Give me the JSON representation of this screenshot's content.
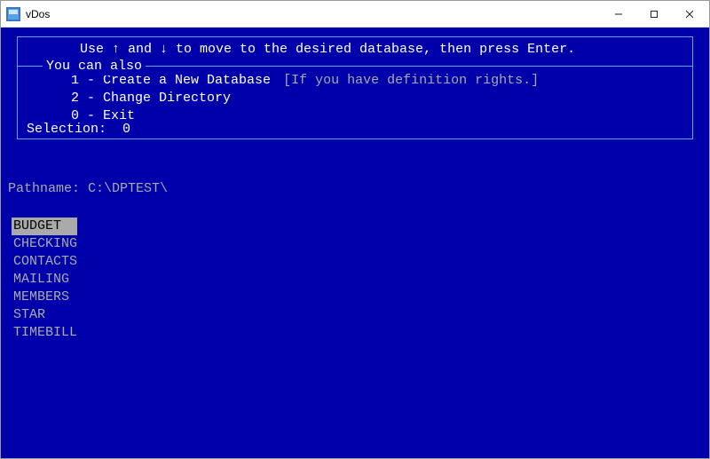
{
  "window": {
    "title": "vDos"
  },
  "terminal": {
    "instruction": "Use ↑ and ↓ to move to the desired database, then press Enter.",
    "subhead": "You can also",
    "options": [
      {
        "num": "1",
        "label": "Create a New Database",
        "note": "[If you have definition rights.]"
      },
      {
        "num": "2",
        "label": "Change Directory",
        "note": ""
      },
      {
        "num": "0",
        "label": "Exit",
        "note": ""
      }
    ],
    "selection_label": "Selection:",
    "selection_value": "0",
    "pathname_label": "Pathname:",
    "pathname_value": "C:\\DPTEST\\",
    "databases": [
      "BUDGET",
      "CHECKING",
      "CONTACTS",
      "MAILING",
      "MEMBERS",
      "STAR",
      "TIMEBILL"
    ],
    "selected_index": 0
  },
  "colors": {
    "bg": "#0000aa",
    "fg_dim": "#aaaaaa",
    "fg_bright": "#ffffff",
    "border": "#55aaff"
  }
}
